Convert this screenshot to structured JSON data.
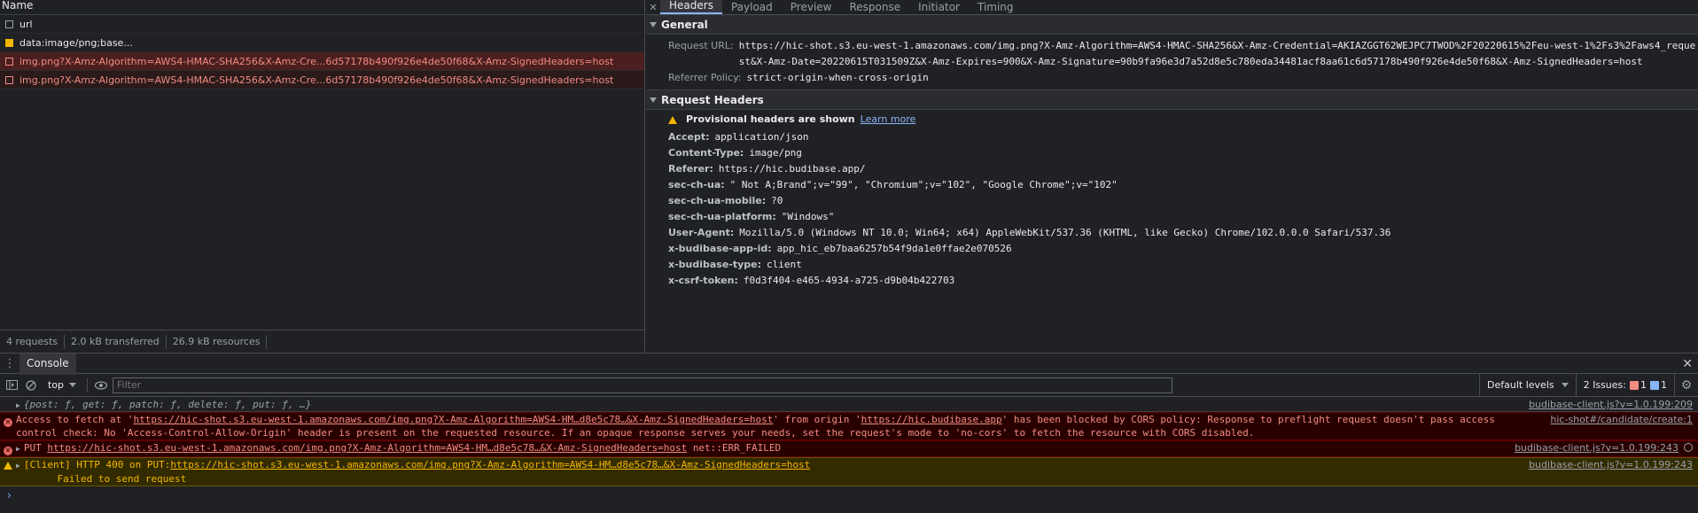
{
  "network": {
    "column_header": "Name",
    "requests": [
      {
        "name": "url"
      },
      {
        "name": "data:image/png;base..."
      },
      {
        "name": "img.png?X-Amz-Algorithm=AWS4-HMAC-SHA256&X-Amz-Cre...6d57178b490f926e4de50f68&X-Amz-SignedHeaders=host"
      },
      {
        "name": "img.png?X-Amz-Algorithm=AWS4-HMAC-SHA256&X-Amz-Cre...6d57178b490f926e4de50f68&X-Amz-SignedHeaders=host"
      }
    ],
    "status": {
      "requests": "4 requests",
      "transferred": "2.0 kB transferred",
      "resources": "26.9 kB resources"
    }
  },
  "details": {
    "tabs": [
      "Headers",
      "Payload",
      "Preview",
      "Response",
      "Initiator",
      "Timing"
    ],
    "general": {
      "title": "General",
      "request_url_label": "Request URL:",
      "request_url": "https://hic-shot.s3.eu-west-1.amazonaws.com/img.png?X-Amz-Algorithm=AWS4-HMAC-SHA256&X-Amz-Credential=AKIAZGGT62WEJPC7TWOD%2F20220615%2Feu-west-1%2Fs3%2Faws4_request&X-Amz-Date=20220615T031509Z&X-Amz-Expires=900&X-Amz-Signature=90b9fa96e3d7a52d8e5c780eda34481acf8aa61c6d57178b490f926e4de50f68&X-Amz-SignedHeaders=host",
      "referrer_policy_label": "Referrer Policy:",
      "referrer_policy": "strict-origin-when-cross-origin"
    },
    "request_headers": {
      "title": "Request Headers",
      "warning": "Provisional headers are shown",
      "learn_more": "Learn more",
      "items": [
        {
          "k": "Accept:",
          "v": "application/json"
        },
        {
          "k": "Content-Type:",
          "v": "image/png"
        },
        {
          "k": "Referer:",
          "v": "https://hic.budibase.app/"
        },
        {
          "k": "sec-ch-ua:",
          "v": "\" Not A;Brand\";v=\"99\", \"Chromium\";v=\"102\", \"Google Chrome\";v=\"102\""
        },
        {
          "k": "sec-ch-ua-mobile:",
          "v": "?0"
        },
        {
          "k": "sec-ch-ua-platform:",
          "v": "\"Windows\""
        },
        {
          "k": "User-Agent:",
          "v": "Mozilla/5.0 (Windows NT 10.0; Win64; x64) AppleWebKit/537.36 (KHTML, like Gecko) Chrome/102.0.0.0 Safari/537.36"
        },
        {
          "k": "x-budibase-app-id:",
          "v": "app_hic_eb7baa6257b54f9da1e0ffae2e070526"
        },
        {
          "k": "x-budibase-type:",
          "v": "client"
        },
        {
          "k": "x-csrf-token:",
          "v": "f0d3f404-e465-4934-a725-d9b04b422703"
        }
      ]
    }
  },
  "console": {
    "tab": "Console",
    "context": "top",
    "filter_placeholder": "Filter",
    "levels": "Default levels",
    "issues_label": "2 Issues:",
    "issues_errors": "1",
    "issues_info": "1",
    "messages": {
      "info_text": "{post: ƒ, get: ƒ, patch: ƒ, delete: ƒ, put: ƒ, …}",
      "info_src": "budibase-client.js?v=1.0.199:209",
      "cors_1": "Access to fetch at '",
      "cors_url": "https://hic-shot.s3.eu-west-1.amazonaws.com/img.png?X-Amz-Algorithm=AWS4-HM…d8e5c78…&X-Amz-SignedHeaders=host",
      "cors_2": "' from origin '",
      "cors_origin": "https://hic.budibase.app",
      "cors_3": "' has been blocked by CORS policy: Response to preflight request doesn't pass access control check: No 'Access-Control-Allow-Origin' header is present on the requested resource. If an opaque response serves your needs, set the request's mode to 'no-cors' to fetch the resource with CORS disabled.",
      "cors_src": "hic-shot#/candidate/create:1",
      "put_prefix": "PUT",
      "put_url": "https://hic-shot.s3.eu-west-1.amazonaws.com/img.png?X-Amz-Algorithm=AWS4-HM…d8e5c78…&X-Amz-SignedHeaders=host",
      "put_err": "net::ERR_FAILED",
      "put_src": "budibase-client.js?v=1.0.199:243",
      "warn_prefix": "[Client] HTTP 400 on PUT:",
      "warn_url": "https://hic-shot.s3.eu-west-1.amazonaws.com/img.png?X-Amz-Algorithm=AWS4-HM…d8e5c78…&X-Amz-SignedHeaders=host",
      "warn_line2": "Failed to send request",
      "warn_src": "budibase-client.js?v=1.0.199:243"
    },
    "prompt": "›"
  }
}
